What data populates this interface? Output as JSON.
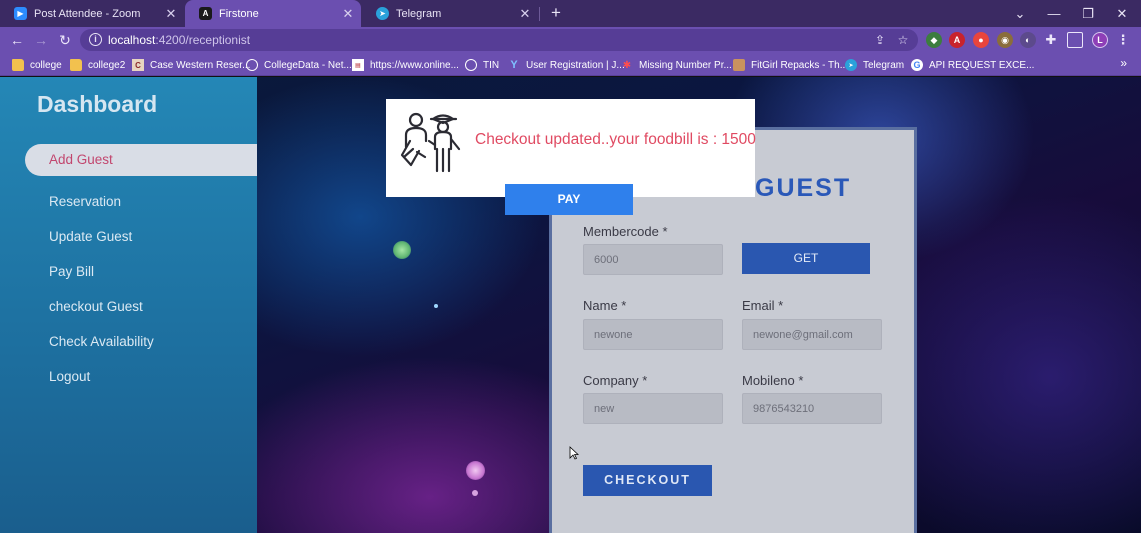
{
  "browser": {
    "tabs": [
      {
        "title": "Post Attendee - Zoom",
        "icon": "zoom-icon",
        "active": false
      },
      {
        "title": "Firstone",
        "icon": "angular-icon",
        "active": true
      },
      {
        "title": "Telegram",
        "icon": "telegram-icon",
        "active": false
      }
    ],
    "close_glyph": "✕",
    "new_tab": "+",
    "url_host": "localhost",
    "url_path": ":4200/receptionist",
    "profile_initial": "L",
    "bookmarks": [
      {
        "label": "college",
        "icon": "folder-icon"
      },
      {
        "label": "college2",
        "icon": "folder-icon"
      },
      {
        "label": "Case Western Reser...",
        "icon": "cwru-icon"
      },
      {
        "label": "CollegeData - Net...",
        "icon": "globe-icon"
      },
      {
        "label": "https://www.online...",
        "icon": "news-icon"
      },
      {
        "label": "TIN",
        "icon": "globe-icon"
      },
      {
        "label": "User Registration | J...",
        "icon": "y-icon"
      },
      {
        "label": "Missing Number Pr...",
        "icon": "bug-icon"
      },
      {
        "label": "FitGirl Repacks - Th...",
        "icon": "fitgirl-icon"
      },
      {
        "label": "Telegram",
        "icon": "telegram-icon"
      },
      {
        "label": "API REQUEST EXCE...",
        "icon": "google-icon"
      }
    ],
    "bookmarks_more": "»"
  },
  "sidebar": {
    "title": "Dashboard",
    "items": [
      {
        "label": "Add Guest",
        "active": true
      },
      {
        "label": "Reservation"
      },
      {
        "label": "Update Guest"
      },
      {
        "label": "Pay Bill"
      },
      {
        "label": "checkout Guest"
      },
      {
        "label": "Check Availability"
      },
      {
        "label": "Logout"
      }
    ]
  },
  "form": {
    "heading": "GUEST",
    "membercode_label": "Membercode *",
    "membercode_value": "6000",
    "get_label": "GET",
    "name_label": "Name *",
    "name_value": "newone",
    "email_label": "Email *",
    "email_value": "newone@gmail.com",
    "company_label": "Company *",
    "company_value": "new",
    "mobile_label": "Mobileno *",
    "mobile_value": "9876543210",
    "checkout_label": "CHECKOUT"
  },
  "dialog": {
    "message": "Checkout updated..your foodbill is : 1500",
    "pay_label": "PAY",
    "icon": "traveler-with-luggage-icon"
  },
  "colors": {
    "tab_bar": "#3b2a63",
    "toolbar": "#6b4fb0",
    "sidebar": "#2487b6",
    "accent_blue": "#2a57b0",
    "pay_blue": "#2f80ec",
    "dialog_text": "#e04a62"
  }
}
